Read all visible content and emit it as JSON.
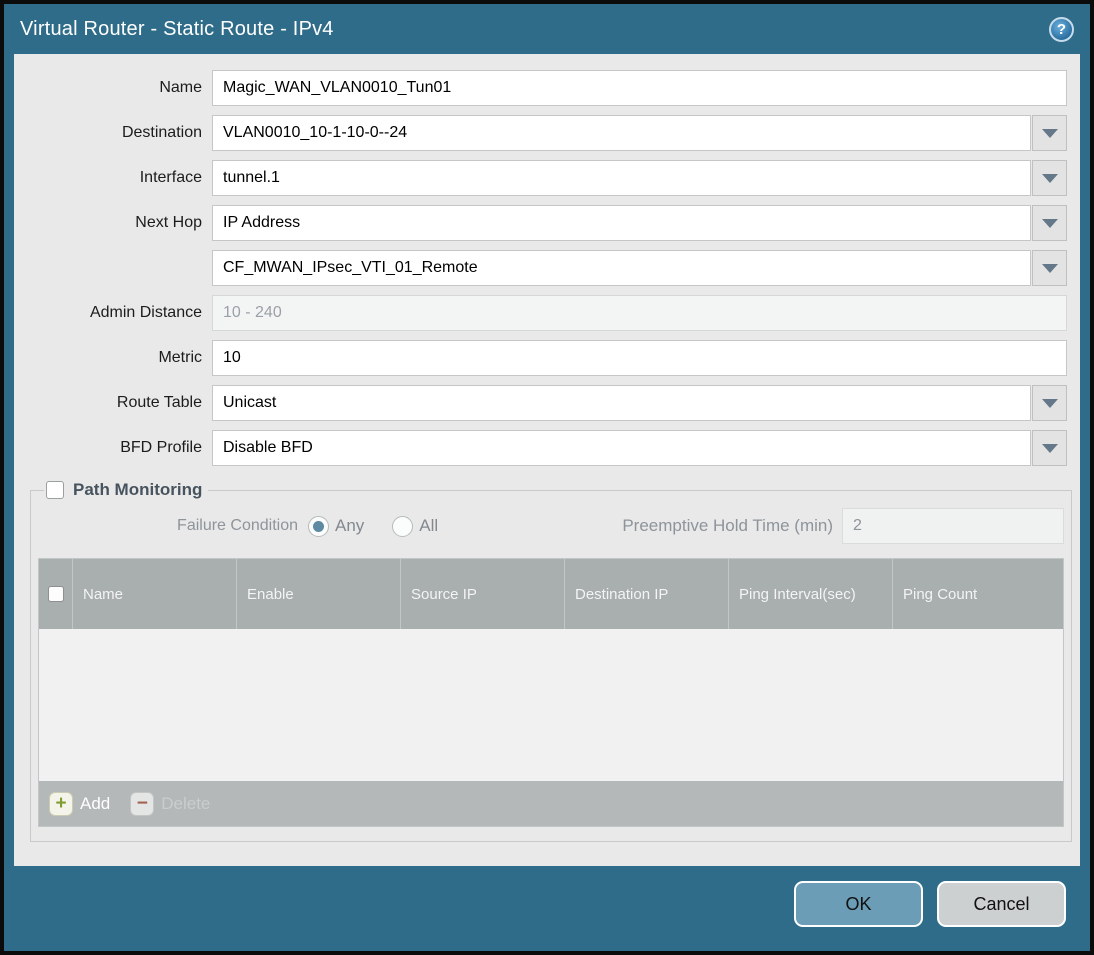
{
  "window": {
    "title": "Virtual Router - Static Route - IPv4",
    "help_icon": "?"
  },
  "form": {
    "name": {
      "label": "Name",
      "value": "Magic_WAN_VLAN0010_Tun01"
    },
    "destination": {
      "label": "Destination",
      "value": "VLAN0010_10-1-10-0--24"
    },
    "interface": {
      "label": "Interface",
      "value": "tunnel.1"
    },
    "next_hop": {
      "label": "Next Hop",
      "value": "IP Address"
    },
    "next_hop_value": {
      "value": "CF_MWAN_IPsec_VTI_01_Remote"
    },
    "admin_distance": {
      "label": "Admin Distance",
      "placeholder": "10 - 240"
    },
    "metric": {
      "label": "Metric",
      "value": "10"
    },
    "route_table": {
      "label": "Route Table",
      "value": "Unicast"
    },
    "bfd_profile": {
      "label": "BFD Profile",
      "value": "Disable BFD"
    }
  },
  "path_monitoring": {
    "title": "Path Monitoring",
    "checked": false,
    "failure_condition": {
      "label": "Failure Condition",
      "options": [
        {
          "label": "Any",
          "selected": true
        },
        {
          "label": "All",
          "selected": false
        }
      ]
    },
    "preemptive_hold_time": {
      "label": "Preemptive Hold Time (min)",
      "value": "2"
    },
    "table": {
      "headers": [
        "Name",
        "Enable",
        "Source IP",
        "Destination IP",
        "Ping Interval(sec)",
        "Ping Count"
      ],
      "rows": [],
      "add_label": "Add",
      "delete_label": "Delete"
    }
  },
  "footer": {
    "ok_label": "OK",
    "cancel_label": "Cancel"
  },
  "colors": {
    "frame_teal": "#2e6c8a",
    "content_bg": "#e9e9e9",
    "table_header_bg": "#a9aeae",
    "table_footer_bg": "#b4b8b8",
    "ok_button_bg": "#6b9db6",
    "cancel_button_bg": "#ccd0d0",
    "radio_selected": "#5d89a2",
    "add_plus": "#7f9d31",
    "delete_minus": "#a2614f"
  }
}
